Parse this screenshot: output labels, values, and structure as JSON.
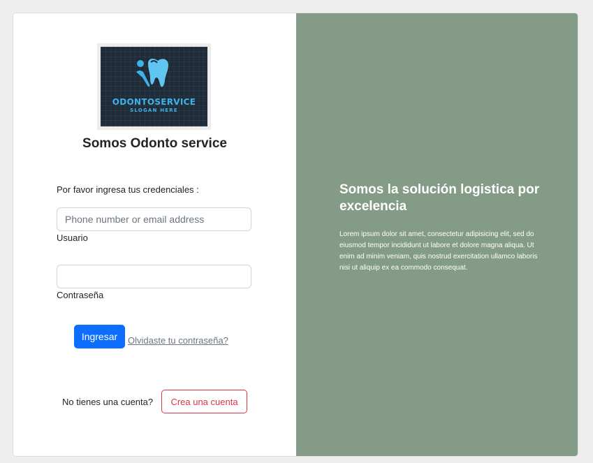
{
  "brand": {
    "logo_name": "ODONTOSERVICE",
    "logo_slogan": "SLOGAN HERE",
    "title": "Somos Odonto service",
    "logo_color": "#3fb2ea"
  },
  "login": {
    "prompt": "Por favor ingresa tus credenciales :",
    "user_placeholder": "Phone number or email address",
    "user_value": "",
    "user_label": "Usuario",
    "password_value": "",
    "password_label": "Contraseña",
    "submit_label": "Ingresar",
    "forgot_label": "Olvidaste tu contraseña?",
    "no_account_text": "No tienes una cuenta?",
    "create_account_label": "Crea una cuenta"
  },
  "promo": {
    "headline": "Somos la solución logistica por excelencia",
    "body": "Lorem ipsum dolor sit amet, consectetur adipisicing elit, sed do eiusmod tempor incididunt ut labore et dolore magna aliqua. Ut enim ad minim veniam, quis nostrud exercitation ullamco laboris nisi ut aliquip ex ea commodo consequat."
  },
  "colors": {
    "primary": "#0d6efd",
    "danger": "#dc3545",
    "panel_bg": "#849b88"
  }
}
